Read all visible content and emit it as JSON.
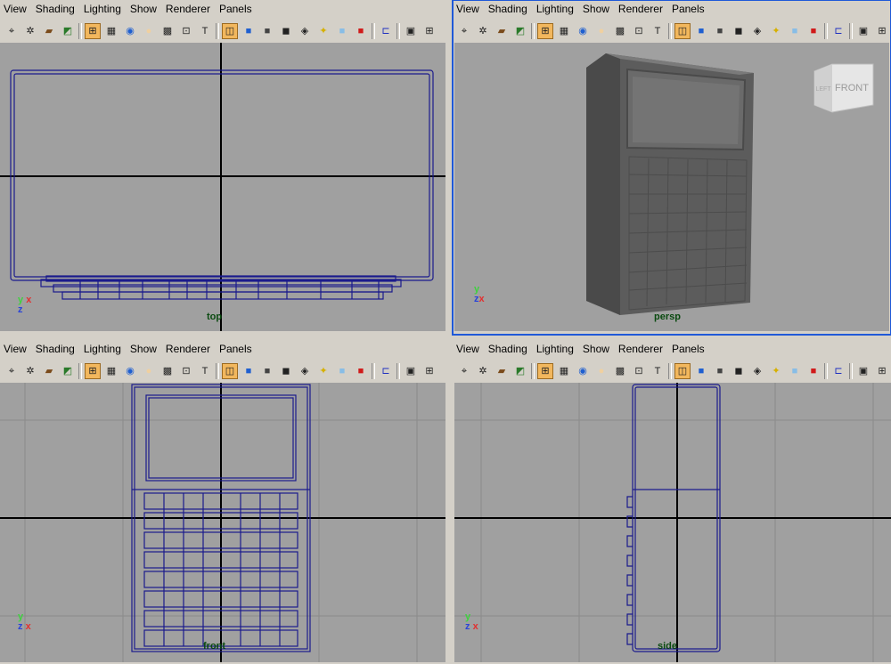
{
  "menus": [
    "View",
    "Shading",
    "Lighting",
    "Show",
    "Renderer",
    "Panels"
  ],
  "toolbar_icons": [
    "select-camera-icon",
    "camera-attributes-icon",
    "bookmark-icon",
    "image-plane-icon",
    "sep",
    "grid-icon",
    "film-gate-icon",
    "resolution-gate-icon",
    "gate-mask-icon",
    "field-chart-icon",
    "safe-action-icon",
    "safe-title-icon",
    "sep",
    "wireframe-icon",
    "smooth-shade-icon",
    "default-material-icon",
    "xray-icon",
    "textured-icon",
    "lights-icon",
    "shadows-icon",
    "ambient-occlusion-icon",
    "sep",
    "isolate-select-icon",
    "sep",
    "single-pane-icon",
    "four-pane-icon"
  ],
  "icon_glyphs": {
    "select-camera-icon": "⌖",
    "camera-attributes-icon": "✲",
    "bookmark-icon": "▰",
    "image-plane-icon": "◩",
    "grid-icon": "⊞",
    "film-gate-icon": "▦",
    "resolution-gate-icon": "◉",
    "gate-mask-icon": "●",
    "field-chart-icon": "▩",
    "safe-action-icon": "⊡",
    "safe-title-icon": "T",
    "wireframe-icon": "◫",
    "smooth-shade-icon": "■",
    "default-material-icon": "■",
    "xray-icon": "◼",
    "textured-icon": "◈",
    "lights-icon": "✦",
    "shadows-icon": "■",
    "ambient-occlusion-icon": "■",
    "isolate-select-icon": "⊏",
    "single-pane-icon": "▣",
    "four-pane-icon": "⊞"
  },
  "viewports": [
    {
      "id": "top",
      "label": "top",
      "active": false,
      "axis": {
        "top": "y x",
        "bottom": "z"
      }
    },
    {
      "id": "persp",
      "label": "persp",
      "active": true,
      "axis": {
        "top": "y",
        "bottom": "z x"
      },
      "viewcube": {
        "left": "LEFT",
        "front": "FRONT"
      }
    },
    {
      "id": "front",
      "label": "front",
      "active": false,
      "axis": {
        "top": "y",
        "bottom": "z x"
      }
    },
    {
      "id": "side",
      "label": "side",
      "active": false,
      "axis": {
        "top": "y",
        "bottom": "z x"
      }
    }
  ],
  "colors": {
    "viewport_bg": "#a0a0a0",
    "grid": "#8a8a8a",
    "axis_line": "#000000",
    "wire": "#1a1a8c",
    "active_border": "#1f59d8",
    "label": "#0a4a10"
  }
}
